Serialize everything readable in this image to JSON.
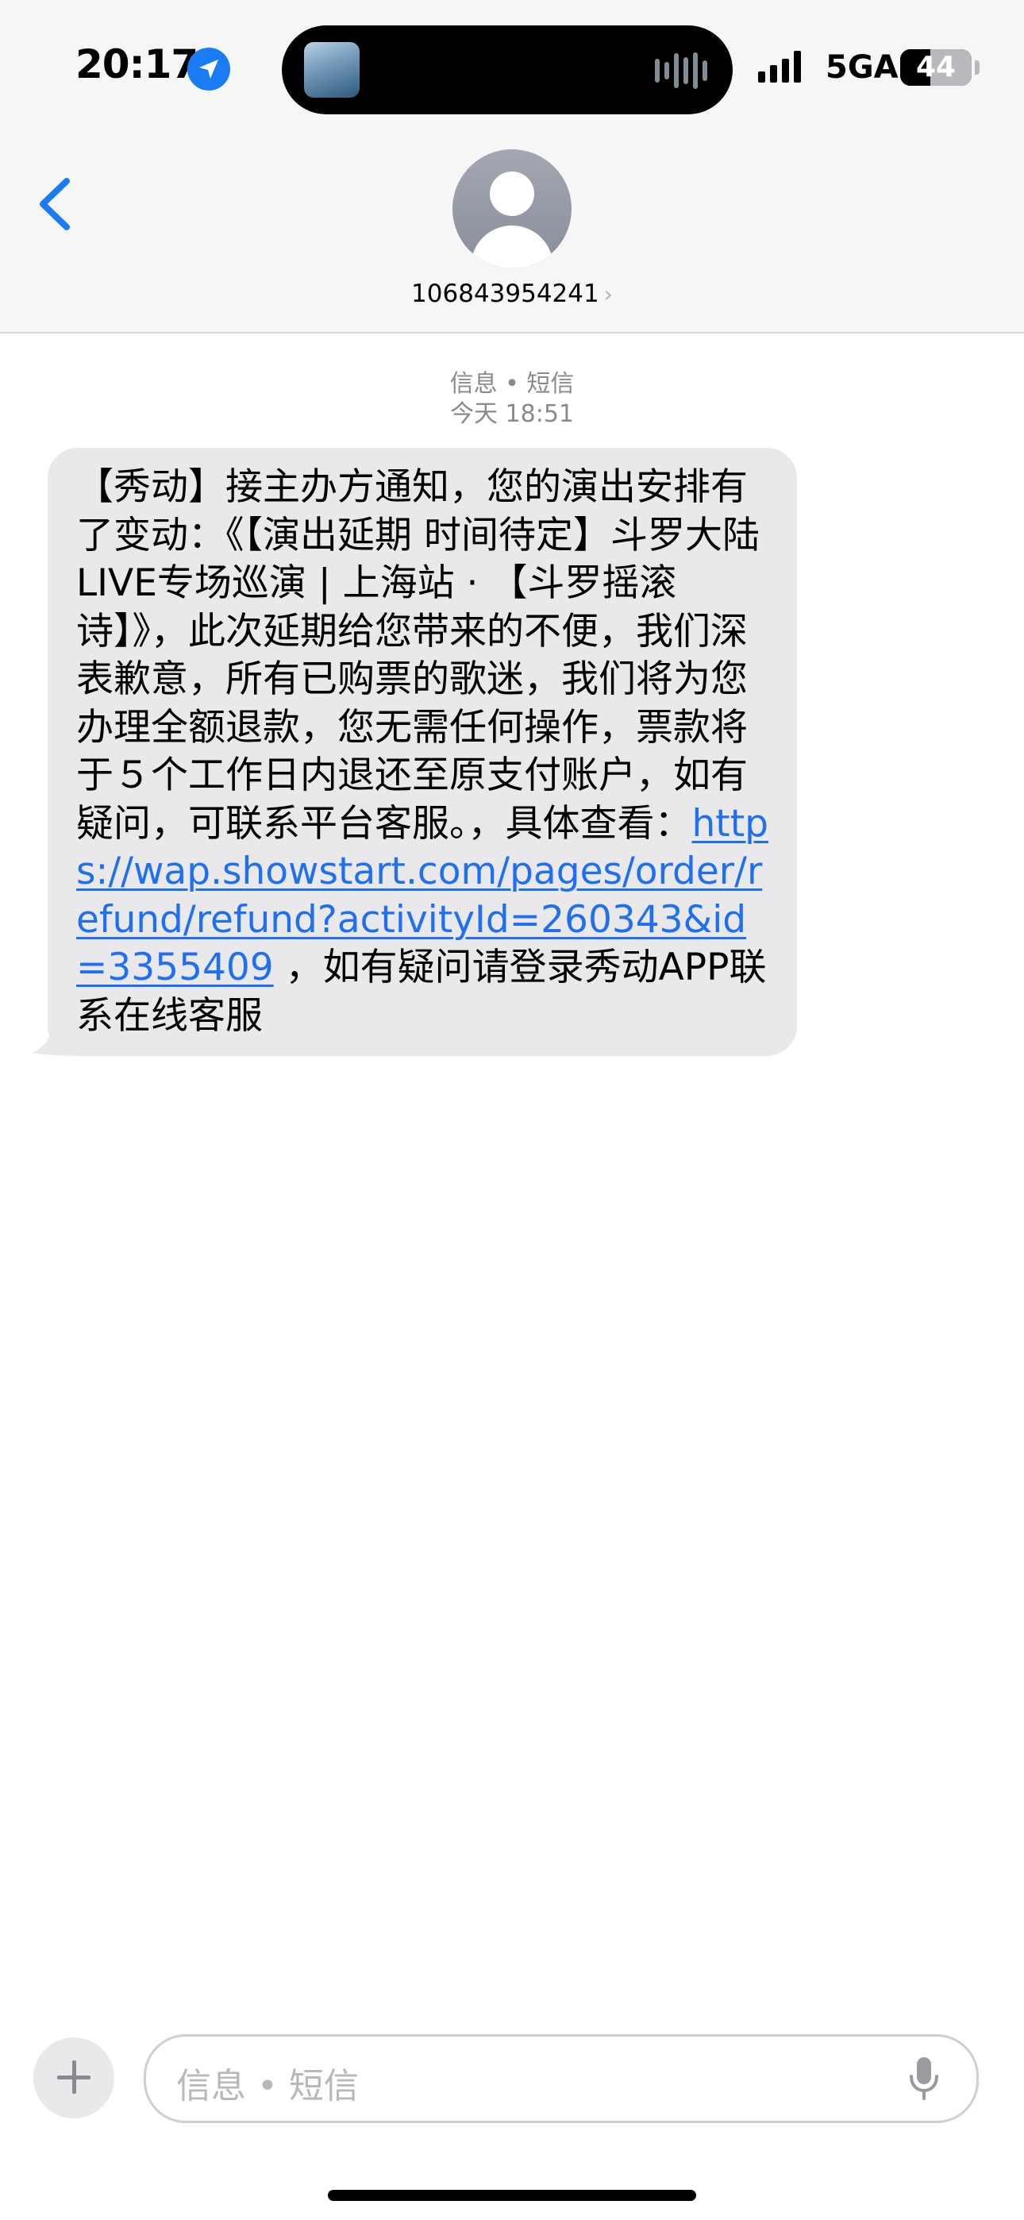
{
  "status_bar": {
    "time": "20:17",
    "network": "5GA",
    "battery": "44"
  },
  "nav": {
    "contact": "106843954241",
    "chevron": "›"
  },
  "conversation": {
    "service": "信息 • 短信",
    "timestamp": "今天 18:51"
  },
  "message": {
    "text_before_link": "【秀动】接主办方通知，您的演出安排有了变动：《【演出延期 时间待定】斗罗大陆LIVE专场巡演 | 上海站 · 【斗罗摇滚诗】》，此次延期给您带来的不便，我们深表歉意，所有已购票的歌迷，我们将为您办理全额退款，您无需任何操作，票款将于５个工作日内退还至原支付账户，如有疑问，可联系平台客服。，具体查看：",
    "link": "https://wap.showstart.com/pages/order/refund/refund?activityId=260343&id=3355409",
    "text_after_link": " ，如有疑问请登录秀动APP联系在线客服"
  },
  "composer": {
    "placeholder": "信息 • 短信"
  },
  "colors": {
    "accent": "#1a7cf5",
    "link": "#1f6ff2",
    "bubble": "#e9e9eb",
    "meta_text": "#8a8a8e"
  },
  "icons": {
    "back": "chevron-left-icon",
    "location": "location-arrow-icon",
    "avatar": "person-icon",
    "add": "plus-icon",
    "mic": "microphone-icon"
  }
}
